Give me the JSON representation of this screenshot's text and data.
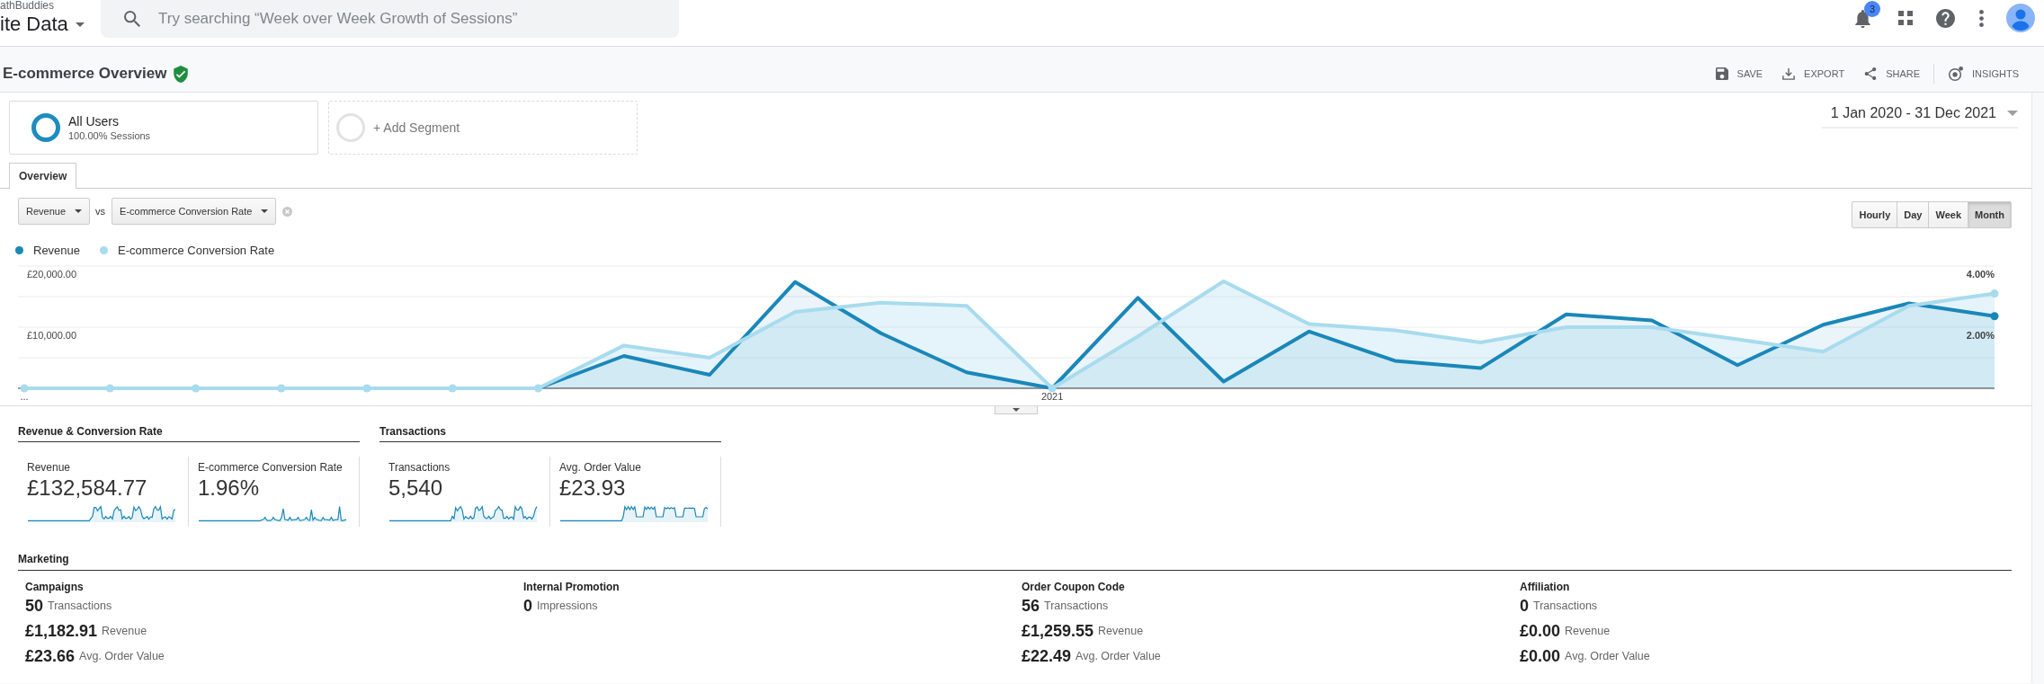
{
  "account": {
    "property": "athBuddies",
    "view": "ite Data"
  },
  "search": {
    "placeholder": "Try searching “Week over Week Growth of Sessions”"
  },
  "notifications": {
    "badge": "3"
  },
  "report": {
    "title": "E-commerce Overview",
    "verified": true,
    "actions": [
      {
        "kind": "save",
        "label": "SAVE"
      },
      {
        "kind": "export",
        "label": "EXPORT"
      },
      {
        "kind": "share",
        "label": "SHARE"
      },
      {
        "kind": "insights",
        "label": "INSIGHTS"
      }
    ]
  },
  "segments": [
    {
      "kind": "active",
      "name": "All Users",
      "detail": "100.00% Sessions"
    },
    {
      "kind": "add",
      "name": "+ Add Segment"
    }
  ],
  "date_range": "1 Jan 2020 - 31 Dec 2021",
  "tabs": [
    {
      "label": "Overview",
      "selected": true
    }
  ],
  "metric_picker": {
    "primary": "Revenue",
    "separator": "vs",
    "secondary": "E-commerce Conversion Rate"
  },
  "granularity": [
    {
      "label": "Hourly",
      "selected": false
    },
    {
      "label": "Day",
      "selected": false
    },
    {
      "label": "Week",
      "selected": false
    },
    {
      "label": "Month",
      "selected": true
    }
  ],
  "chart": {
    "chart_data": {
      "type": "area",
      "categories": [
        "...",
        null,
        null,
        null,
        null,
        null,
        null,
        null,
        null,
        null,
        null,
        null,
        "2021",
        null,
        null,
        null,
        null,
        null,
        null,
        null,
        null,
        null,
        null,
        null
      ],
      "series": [
        {
          "name": "Revenue",
          "color": "#1a87b9",
          "values": [
            null,
            null,
            null,
            null,
            null,
            null,
            0,
            5300,
            2200,
            17400,
            9000,
            2600,
            0,
            14800,
            1100,
            9300,
            4500,
            3300,
            12100,
            11100,
            3800,
            10400,
            13900,
            11800
          ]
        },
        {
          "name": "E-commerce Conversion Rate",
          "color": "#a8dbee",
          "axis": "y2",
          "values": [
            0,
            0,
            0,
            0,
            0,
            0,
            0,
            1.4,
            1.0,
            2.5,
            2.8,
            2.7,
            0,
            1.7,
            3.5,
            2.1,
            1.9,
            1.5,
            2.0,
            2.0,
            1.6,
            1.2,
            2.7,
            3.1
          ]
        }
      ],
      "ylim": [
        0,
        20000
      ],
      "yticks": [
        {
          "value": 10000,
          "label": "£10,000.00"
        },
        {
          "value": 20000,
          "label": "£20,000.00"
        }
      ],
      "y2lim": [
        0,
        4
      ],
      "y2ticks": [
        {
          "value": 2,
          "label": "2.00%"
        },
        {
          "value": 4,
          "label": "4.00%"
        }
      ]
    }
  },
  "sections": [
    {
      "title": "Revenue & Conversion Rate",
      "metrics": [
        {
          "label": "Revenue",
          "value": "£132,584.77"
        },
        {
          "label": "E-commerce Conversion Rate",
          "value": "1.96%"
        }
      ]
    },
    {
      "title": "Transactions",
      "metrics": [
        {
          "label": "Transactions",
          "value": "5,540"
        },
        {
          "label": "Avg. Order Value",
          "value": "£23.93"
        }
      ]
    }
  ],
  "marketing": {
    "title": "Marketing",
    "groups": [
      {
        "title": "Campaigns",
        "metrics": [
          {
            "value": "50",
            "label": "Transactions"
          },
          {
            "value": "£1,182.91",
            "label": "Revenue"
          },
          {
            "value": "£23.66",
            "label": "Avg. Order Value"
          }
        ]
      },
      {
        "title": "Internal Promotion",
        "metrics": [
          {
            "value": "0",
            "label": "Impressions"
          }
        ]
      },
      {
        "title": "Order Coupon Code",
        "metrics": [
          {
            "value": "56",
            "label": "Transactions"
          },
          {
            "value": "£1,259.55",
            "label": "Revenue"
          },
          {
            "value": "£22.49",
            "label": "Avg. Order Value"
          }
        ]
      },
      {
        "title": "Affiliation",
        "metrics": [
          {
            "value": "0",
            "label": "Transactions"
          },
          {
            "value": "£0.00",
            "label": "Revenue"
          },
          {
            "value": "£0.00",
            "label": "Avg. Order Value"
          }
        ]
      }
    ]
  }
}
